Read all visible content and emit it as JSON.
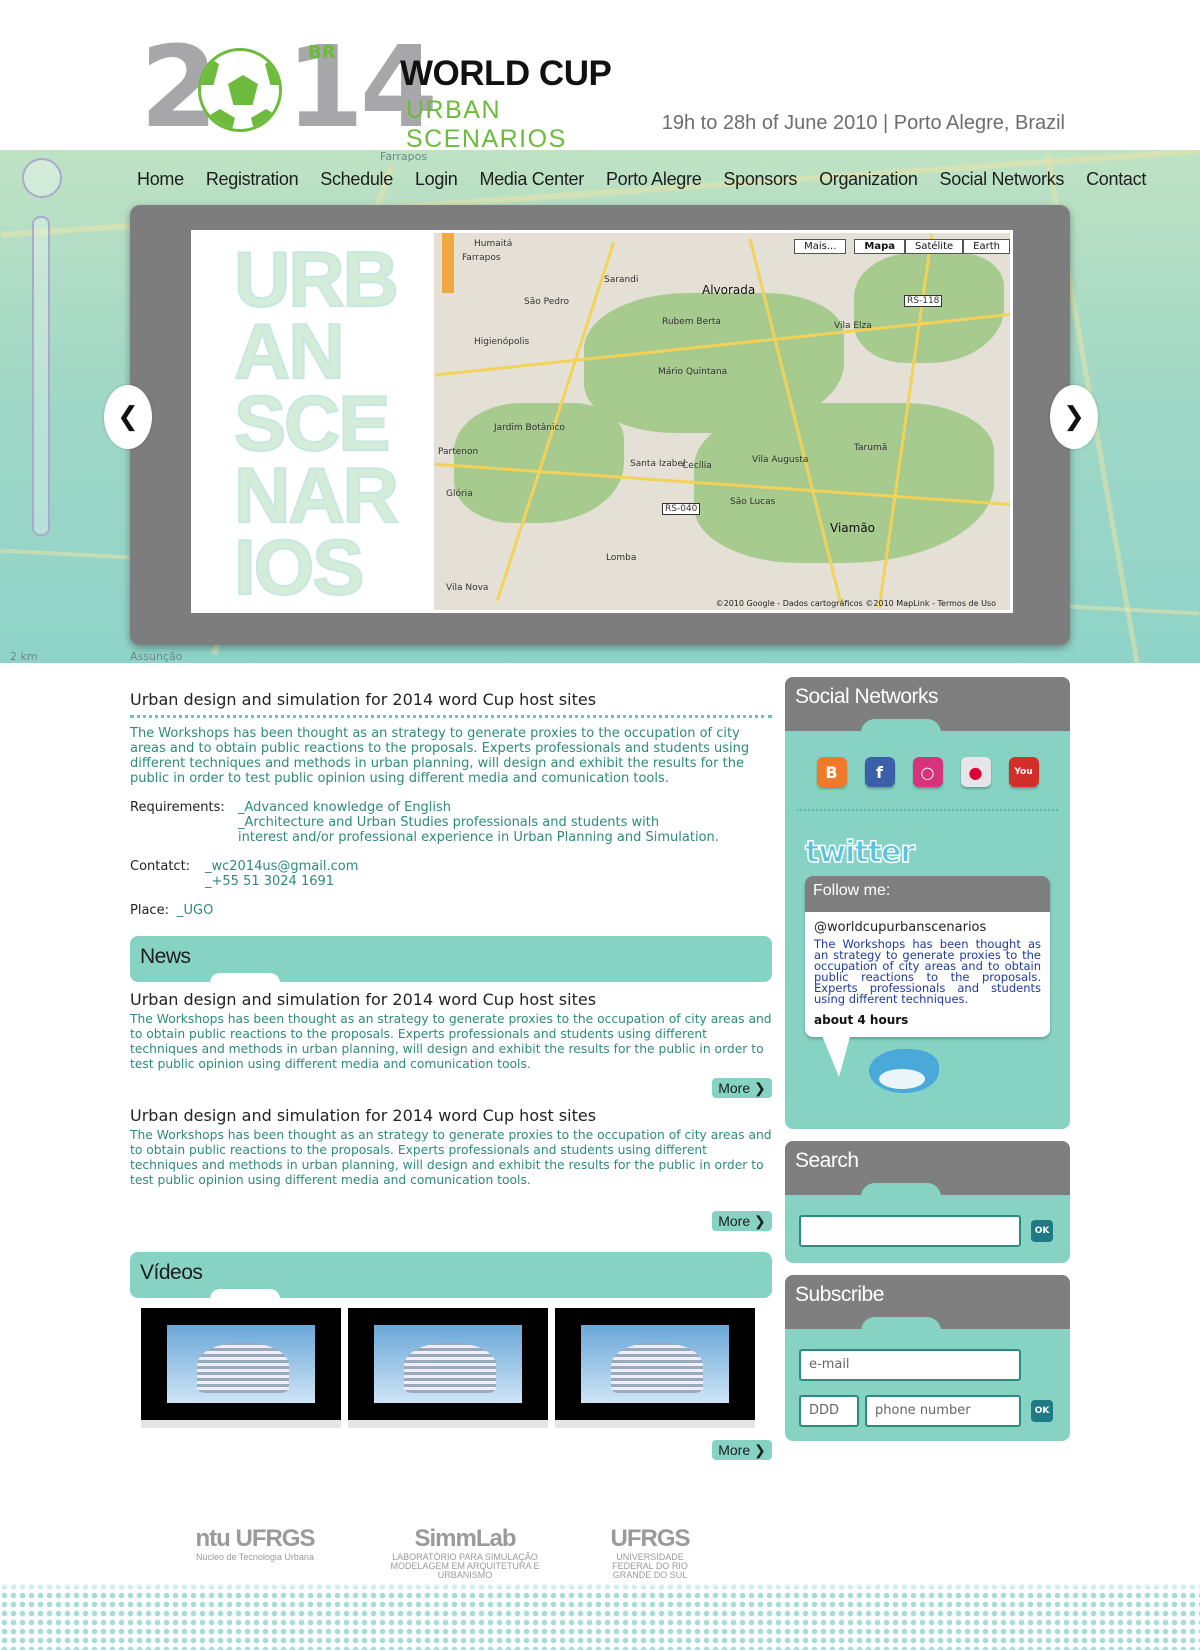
{
  "header": {
    "logo_left": "2",
    "logo_right": "14",
    "logo_br": "BR",
    "logo_title": "WORLD CUP",
    "logo_subtitle": "URBAN  SCENARIOS",
    "event_date": "19h to 28h of June 2010 | Porto Alegre, Brazil"
  },
  "nav": [
    "Home",
    "Registration",
    "Schedule",
    "Login",
    "Media Center",
    "Porto Alegre",
    "Sponsors",
    "Organization",
    "Social Networks",
    "Contact"
  ],
  "slider": {
    "word": [
      "URB",
      "AN",
      "SCE",
      "NAR",
      "IOS"
    ],
    "map_buttons": [
      "Mais...",
      "Mapa",
      "Satélite",
      "Earth"
    ],
    "map_labels": [
      "Humaitá",
      "Farrapos",
      "Sarandi",
      "São Pedro",
      "Alvorada",
      "Higienópolis",
      "Rubem Berta",
      "Vila Elza",
      "Jardim Botânico",
      "Mário Quintana",
      "Partenon",
      "Vila Augusta",
      "Cecília",
      "Santa Izabel",
      "São Lucas",
      "Viamão",
      "Glória",
      "Lomba",
      "Vila Nova",
      "Tarumã",
      "RS-118",
      "RS-040"
    ],
    "map_copyright": "©2010 Google - Dados cartográficos ©2010 MapLink - Termos de Uso",
    "band_labels": [
      "2 km",
      "Assunção",
      "Farrapos"
    ]
  },
  "intro": {
    "title": "Urban design and simulation for 2014 word Cup host sites",
    "text": "The Workshops has been thought as an strategy to generate proxies to the occupation of city areas and to obtain public reactions to the proposals. Experts professionals and students using different techniques and methods in urban planning, will design and exhibit the results for the public in order to test public opinion using different media and comunication tools.",
    "requirements_label": "Requirements:",
    "requirements": [
      "_Advanced knowledge of English",
      "_Architecture and Urban Studies professionals and students with",
      "interest and/or professional experience in Urban Planning and Simulation."
    ],
    "contact_label": "Contatct:",
    "contact": [
      "_wc2014us@gmail.com",
      "_+55 51 3024 1691"
    ],
    "place_label": "Place:",
    "place": "_UGO"
  },
  "news": {
    "heading": "News",
    "items": [
      {
        "title": "Urban design and simulation for 2014 word Cup host sites",
        "text": "The Workshops has been thought as an strategy to generate proxies to the occupation of city areas and to obtain public reactions to the proposals. Experts professionals and students using different techniques and methods in urban planning, will design and exhibit the results for the public in order to test public opinion using different media and comunication tools.",
        "more": "More ❯"
      },
      {
        "title": "Urban design and simulation for 2014 word Cup host sites",
        "text": "The Workshops has been thought as an strategy to generate proxies to the occupation of city areas and to obtain public reactions to the proposals. Experts professionals and students using different techniques and methods in urban planning, will design and exhibit the results for the public in order to test public opinion using different media and comunication tools.",
        "more": "More ❯"
      }
    ]
  },
  "videos": {
    "heading": "Vídeos",
    "more": "More ❯"
  },
  "partners": [
    {
      "name": "ntu  UFRGS",
      "sub": "Núcleo de Tecnologia Urbana"
    },
    {
      "name": "SimmLab",
      "sub": "LABORATÓRIO PARA SIMULAÇÃO MODELAGEM EM ARQUITETURA E URBANISMO"
    },
    {
      "name": "UFRGS",
      "sub": "UNIVERSIDADE FEDERAL DO RIO GRANDE DO SUL"
    }
  ],
  "sidebar": {
    "social_heading": "Social Networks",
    "social_icons": [
      "blogger-icon",
      "facebook-icon",
      "instagram-icon",
      "flickr-icon",
      "youtube-icon"
    ],
    "twitter_logo": "twitter",
    "follow_label": "Follow me:",
    "twitter_handle": "@worldcupurbanscenarios",
    "tweet_text": "The Workshops has been thought as an strategy to generate proxies to the occupation of city areas and to obtain public reactions to the proposals. Experts professionals and students using different techniques.",
    "tweet_time": "about 4 hours",
    "search_heading": "Search",
    "search_value": "",
    "ok_label": "OK",
    "subscribe_heading": "Subscribe",
    "email_placeholder": "e-mail",
    "ddd_placeholder": "DDD",
    "phone_placeholder": "phone number"
  },
  "colors": {
    "accent_teal": "#86d3c4",
    "text_teal": "#2e8a7c",
    "logo_green": "#6cbb3c",
    "panel_gray": "#7f7f7f"
  }
}
